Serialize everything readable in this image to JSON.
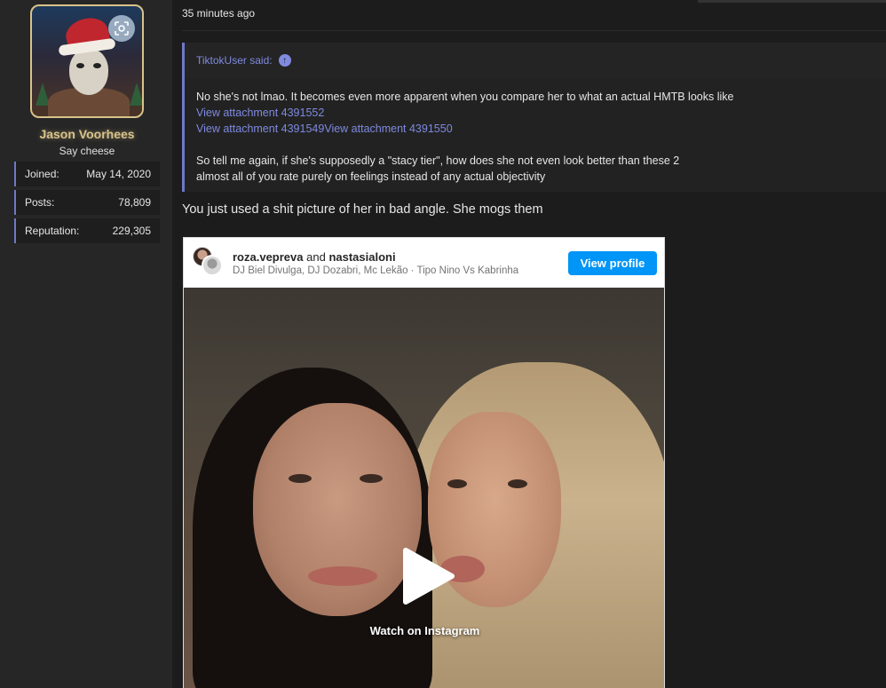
{
  "post": {
    "timestamp": "35 minutes ago",
    "reply_text": "You just used a shit picture of her in bad angle. She mogs them"
  },
  "user": {
    "name": "Jason Voorhees",
    "title": "Say cheese",
    "name_color": "#d9c38a",
    "stats": [
      {
        "label": "Joined:",
        "value": "May 14, 2020"
      },
      {
        "label": "Posts:",
        "value": "78,809"
      },
      {
        "label": "Reputation:",
        "value": "229,305"
      }
    ]
  },
  "quote": {
    "author_said": "TiktokUser said:",
    "line1": "No she's not lmao. It becomes even more apparent when you compare her to what an actual HMTB looks like",
    "attach1": "View attachment 4391552",
    "attach2": "View attachment 4391549",
    "attach3": "View attachment 4391550",
    "line2": "So tell me again, if she's supposedly a \"stacy tier\", how does she not even look better than these 2",
    "line3": "almost all of you rate purely on feelings instead of any actual objectivity"
  },
  "embed": {
    "user1": "roza.vepreva",
    "conj": "and",
    "user2": "nastasialoni",
    "audio": "DJ Biel Divulga, DJ Dozabri, Mc Lekão · Tipo Nino Vs Kabrinha",
    "view_profile": "View profile",
    "watch_label": "Watch on Instagram",
    "button_color": "#0095f6"
  },
  "colors": {
    "background": "#1c1c1c",
    "sidebar": "#262626",
    "accent": "#7f8ae0"
  }
}
